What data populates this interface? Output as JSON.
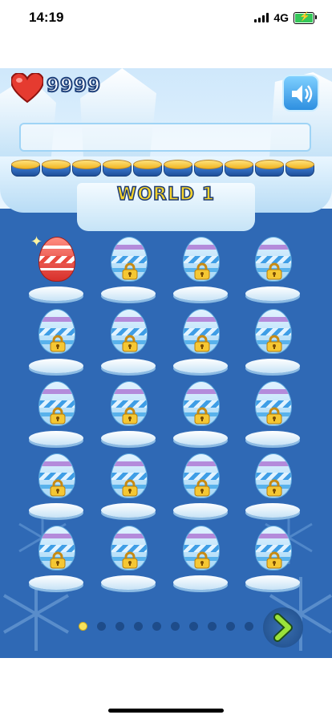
{
  "status_bar": {
    "time": "14:19",
    "network": "4G",
    "battery_charging": true
  },
  "game": {
    "lives": "9999",
    "world_title": "WORLD 1",
    "sound_icon": "speaker-icon",
    "coin_count": 10,
    "colors": {
      "background": "#2f69b5",
      "title_fill": "#f6d32c",
      "unlocked_egg": "#d8302b",
      "locked_egg": "#a7d8f6"
    },
    "levels": [
      {
        "status": "unlocked"
      },
      {
        "status": "locked"
      },
      {
        "status": "locked"
      },
      {
        "status": "locked"
      },
      {
        "status": "locked"
      },
      {
        "status": "locked"
      },
      {
        "status": "locked"
      },
      {
        "status": "locked"
      },
      {
        "status": "locked"
      },
      {
        "status": "locked"
      },
      {
        "status": "locked"
      },
      {
        "status": "locked"
      },
      {
        "status": "locked"
      },
      {
        "status": "locked"
      },
      {
        "status": "locked"
      },
      {
        "status": "locked"
      },
      {
        "status": "locked"
      },
      {
        "status": "locked"
      },
      {
        "status": "locked"
      },
      {
        "status": "locked"
      }
    ],
    "pagination": {
      "total_pages": 10,
      "current_page": 1
    },
    "next_icon": "chevron-right-icon"
  }
}
